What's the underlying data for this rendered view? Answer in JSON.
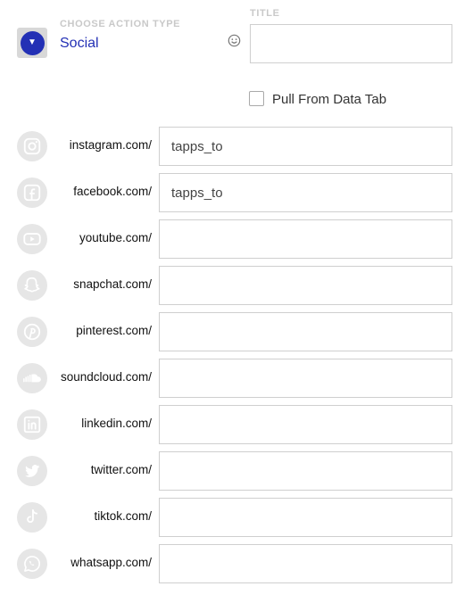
{
  "action_type": {
    "label": "CHOOSE ACTION TYPE",
    "value": "Social"
  },
  "title": {
    "label": "TITLE",
    "value": ""
  },
  "pull_from_data_tab": {
    "label": "Pull From Data Tab",
    "checked": false
  },
  "social": [
    {
      "icon": "instagram-icon",
      "label": "instagram.com/",
      "value": "tapps_to"
    },
    {
      "icon": "facebook-icon",
      "label": "facebook.com/",
      "value": "tapps_to"
    },
    {
      "icon": "youtube-icon",
      "label": "youtube.com/",
      "value": ""
    },
    {
      "icon": "snapchat-icon",
      "label": "snapchat.com/",
      "value": ""
    },
    {
      "icon": "pinterest-icon",
      "label": "pinterest.com/",
      "value": ""
    },
    {
      "icon": "soundcloud-icon",
      "label": "soundcloud.com/",
      "value": ""
    },
    {
      "icon": "linkedin-icon",
      "label": "linkedin.com/",
      "value": ""
    },
    {
      "icon": "twitter-icon",
      "label": "twitter.com/",
      "value": ""
    },
    {
      "icon": "tiktok-icon",
      "label": "tiktok.com/",
      "value": ""
    },
    {
      "icon": "whatsapp-icon",
      "label": "whatsapp.com/",
      "value": ""
    }
  ],
  "colors": {
    "accent": "#2330b5",
    "icon_bg": "#e6e6e6",
    "icon_fg": "#ffffff"
  }
}
